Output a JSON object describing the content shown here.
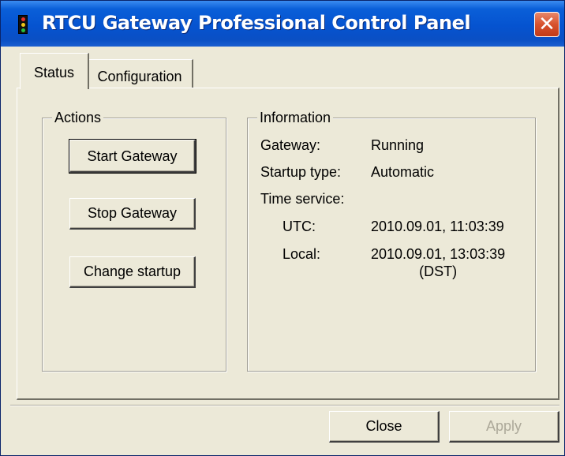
{
  "window": {
    "title": "RTCU Gateway Professional Control Panel",
    "close_glyph": "✕",
    "icon": "traffic-light-icon"
  },
  "tabs": [
    {
      "label": "Status",
      "active": true
    },
    {
      "label": "Configuration",
      "active": false
    }
  ],
  "actions": {
    "legend": "Actions",
    "buttons": [
      {
        "label": "Start Gateway"
      },
      {
        "label": "Stop Gateway"
      },
      {
        "label": "Change startup"
      }
    ]
  },
  "information": {
    "legend": "Information",
    "rows": [
      {
        "label": "Gateway:",
        "value": "Running"
      },
      {
        "label": "Startup type:",
        "value": "Automatic"
      },
      {
        "label": "Time service:",
        "value": ""
      },
      {
        "label": "UTC:",
        "value": "2010.09.01, 11:03:39"
      },
      {
        "label": "Local:",
        "value": "2010.09.01, 13:03:39\n(DST)"
      }
    ]
  },
  "footer": {
    "close_label": "Close",
    "apply_label": "Apply"
  },
  "colors": {
    "titlebar": "#0553d0",
    "face": "#ece9d8",
    "close_button": "#d8522e",
    "disabled_text": "#aca899"
  }
}
